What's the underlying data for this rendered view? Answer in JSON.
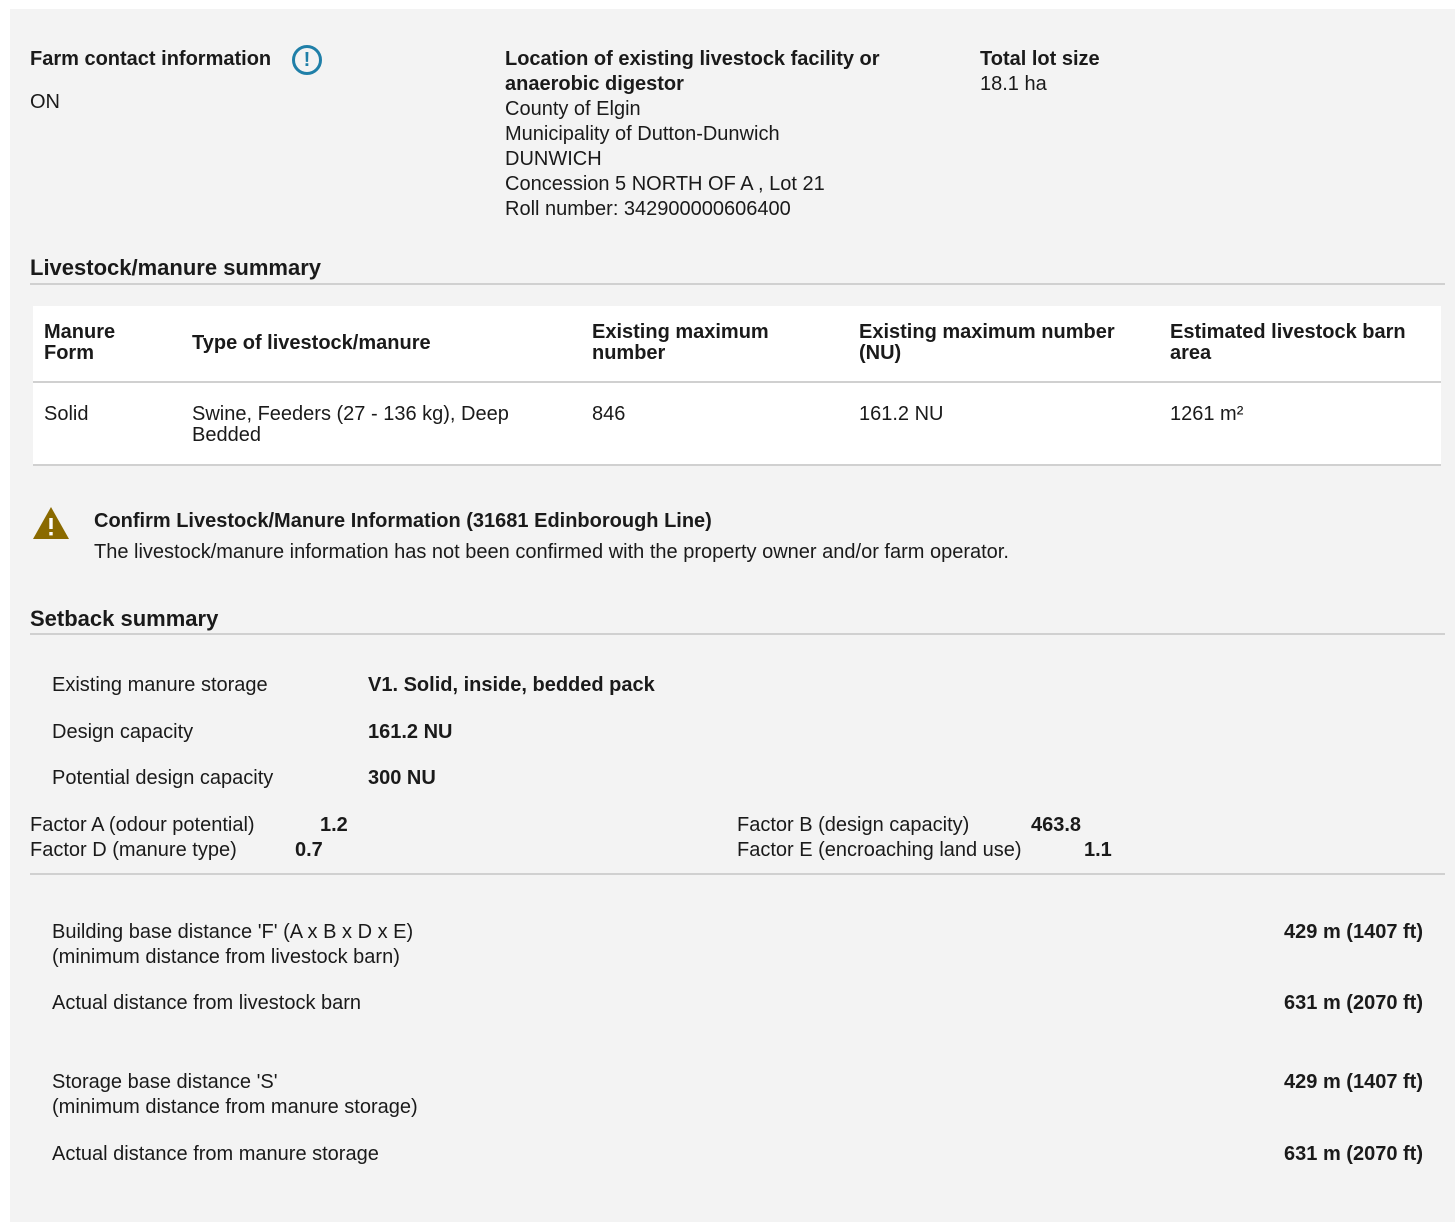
{
  "contact": {
    "label": "Farm contact information",
    "province": "ON"
  },
  "location": {
    "label_line1": "Location of existing livestock facility or",
    "label_line2": "anaerobic digestor",
    "county": "County of Elgin",
    "municipality": "Municipality of Dutton-Dunwich",
    "township": "DUNWICH",
    "concession": "Concession 5 NORTH OF A , Lot 21",
    "roll": "Roll number: 342900000606400"
  },
  "lot": {
    "label": "Total lot size",
    "value": "18.1 ha"
  },
  "livestock_summary": {
    "title": "Livestock/manure summary",
    "headers": {
      "form_l1": "Manure",
      "form_l2": "Form",
      "type": "Type of livestock/manure",
      "max_l1": "Existing maximum",
      "max_l2": "number",
      "nu_l1": "Existing maximum number",
      "nu_l2": "(NU)",
      "area_l1": "Estimated livestock barn",
      "area_l2": "area"
    },
    "row": {
      "form": "Solid",
      "type_l1": "Swine, Feeders (27 - 136 kg), Deep",
      "type_l2": "Bedded",
      "max": "846",
      "nu": "161.2 NU",
      "area": "1261 m²"
    }
  },
  "warning": {
    "icon": "warning-triangle-icon",
    "title": "Confirm Livestock/Manure Information (31681 Edinborough Line)",
    "message": "The livestock/manure information has not been confirmed with the property owner and/or farm operator."
  },
  "setback": {
    "title": "Setback summary",
    "storage_label": "Existing manure storage",
    "storage_value": "V1. Solid, inside, bedded pack",
    "design_label": "Design capacity",
    "design_value": "161.2 NU",
    "potential_label": "Potential design capacity",
    "potential_value": "300 NU",
    "factor_a_label": "Factor A (odour potential)",
    "factor_a_value": "1.2",
    "factor_b_label": "Factor B (design capacity)",
    "factor_b_value": "463.8",
    "factor_d_label": "Factor D (manure type)",
    "factor_d_value": "0.7",
    "factor_e_label": "Factor E (encroaching land use)",
    "factor_e_value": "1.1",
    "building_base_l1": "Building base distance 'F' (A x B x D x E)",
    "building_base_l2": "(minimum distance from livestock barn)",
    "building_base_value": "429 m (1407 ft)",
    "actual_barn_label": "Actual distance from livestock barn",
    "actual_barn_value": "631 m (2070 ft)",
    "storage_base_l1": "Storage base distance 'S'",
    "storage_base_l2": "(minimum distance from manure storage)",
    "storage_base_value": "429 m (1407 ft)",
    "actual_storage_label": "Actual distance from manure storage",
    "actual_storage_value": "631 m (2070 ft)"
  },
  "colors": {
    "info_icon": "#1f7fa8",
    "warning_icon": "#8a6a00"
  }
}
